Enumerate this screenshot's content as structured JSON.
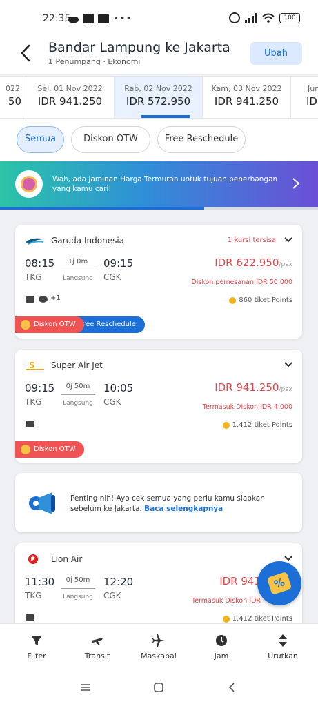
{
  "status_bar": {
    "time": "22:35",
    "battery": "100"
  },
  "header": {
    "title": "Bandar Lampung ke Jakarta",
    "subtitle": "1 Penumpang · Ekonomi",
    "edit_label": "Ubah"
  },
  "dates": [
    {
      "day": "022",
      "price": "50"
    },
    {
      "day": "Sel, 01 Nov 2022",
      "price": "IDR 941.250"
    },
    {
      "day": "Rab, 02 Nov 2022",
      "price": "IDR 572.950"
    },
    {
      "day": "Kam, 03 Nov 2022",
      "price": "IDR 941.250"
    },
    {
      "day": "Jum",
      "price": "ID"
    }
  ],
  "chips": [
    "Semua",
    "Diskon OTW",
    "Free Reschedule"
  ],
  "banner": {
    "text": "Wah, ada Jaminan Harga Termurah untuk tujuan penerbangan yang kamu cari!"
  },
  "flights": [
    {
      "airline": "Garuda Indonesia",
      "seats": "1 kursi tersisa",
      "dep_time": "08:15",
      "dep_code": "TKG",
      "duration": "1j 0m",
      "type": "Langsung",
      "arr_time": "09:15",
      "arr_code": "CGK",
      "price": "IDR 622.950",
      "per": "/pax",
      "discount": "Diskon pemesanan IDR 50.000",
      "points": "860 tiket Points",
      "amenity_more": "+1",
      "tag_otw": "Diskon OTW",
      "tag_fr": "Free Reschedule"
    },
    {
      "airline": "Super Air Jet",
      "dep_time": "09:15",
      "dep_code": "TKG",
      "duration": "0j 50m",
      "type": "Langsung",
      "arr_time": "10:05",
      "arr_code": "CGK",
      "price": "IDR 941.250",
      "per": "/pax",
      "discount": "Termasuk Diskon IDR 4.000",
      "points": "1.412 tiket Points",
      "tag_otw": "Diskon OTW"
    },
    {
      "airline": "Lion Air",
      "dep_time": "11:30",
      "dep_code": "TKG",
      "duration": "0j 50m",
      "type": "Langsung",
      "arr_time": "12:20",
      "arr_code": "CGK",
      "price": "IDR 941",
      "discount": "Termasuk Diskon IDR",
      "points": "1.412 tiket Points"
    }
  ],
  "info": {
    "text": "Penting nih! Ayo cek semua yang perlu kamu siapkan sebelum ke Jakarta.",
    "link": "Baca selengkapnya"
  },
  "fab": {
    "symbol": "%"
  },
  "bottom_nav": [
    "Filter",
    "Transit",
    "Maskapai",
    "Jam",
    "Urutkan"
  ],
  "colors": {
    "primary": "#1d6fd8",
    "price": "#e0464a",
    "otw": "#ef5353"
  }
}
